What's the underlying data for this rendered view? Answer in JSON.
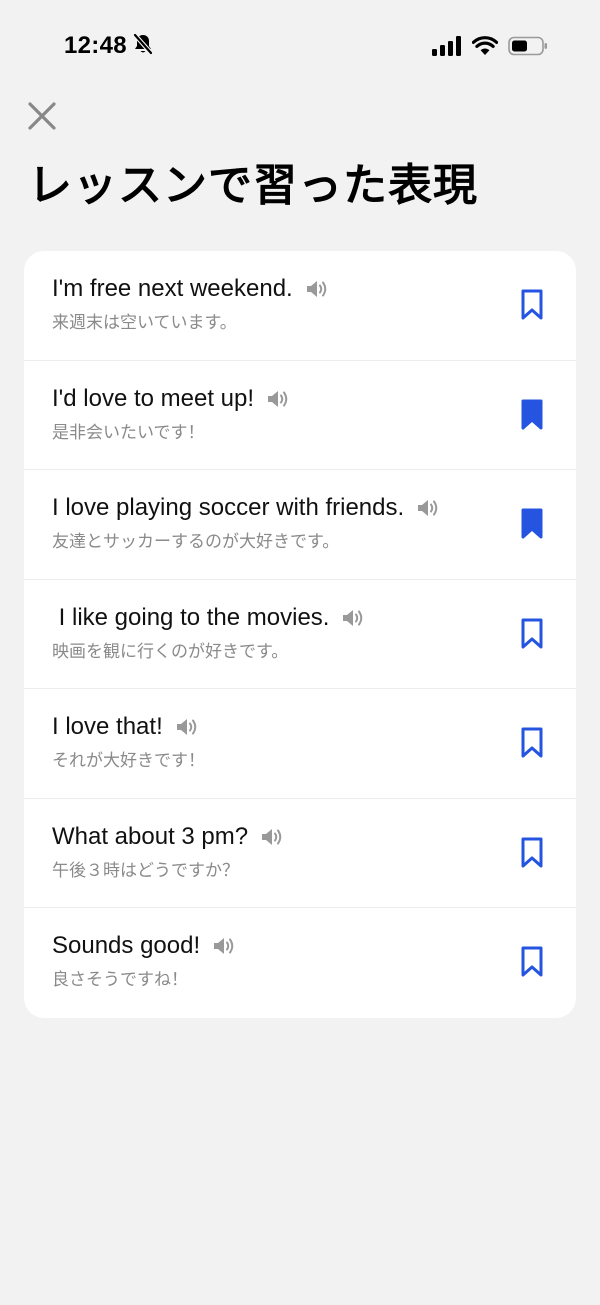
{
  "status_bar": {
    "time": "12:48",
    "icons": [
      "bell-slash-icon",
      "signal-icon",
      "wifi-icon",
      "battery-icon"
    ]
  },
  "header": {
    "close_icon": "close-icon",
    "title": "レッスンで習った表現"
  },
  "colors": {
    "accent": "#2454e0",
    "background": "#f2f2f2",
    "card": "#ffffff",
    "secondary_text": "#8a8a8a"
  },
  "phrases": [
    {
      "en": "I'm free next weekend.",
      "ja": "来週末は空いています。",
      "bookmarked": false
    },
    {
      "en": "I'd love to meet up!",
      "ja": "是非会いたいです！",
      "bookmarked": true
    },
    {
      "en": "I love playing soccer with friends.",
      "ja": "友達とサッカーするのが大好きです。",
      "bookmarked": true
    },
    {
      "en": " I like going to the movies.",
      "ja": "映画を観に行くのが好きです。",
      "bookmarked": false
    },
    {
      "en": "I love that!",
      "ja": "それが大好きです！",
      "bookmarked": false
    },
    {
      "en": "What about 3 pm?",
      "ja": "午後３時はどうですか？",
      "bookmarked": false
    },
    {
      "en": "Sounds good!",
      "ja": "良さそうですね！",
      "bookmarked": false
    }
  ]
}
